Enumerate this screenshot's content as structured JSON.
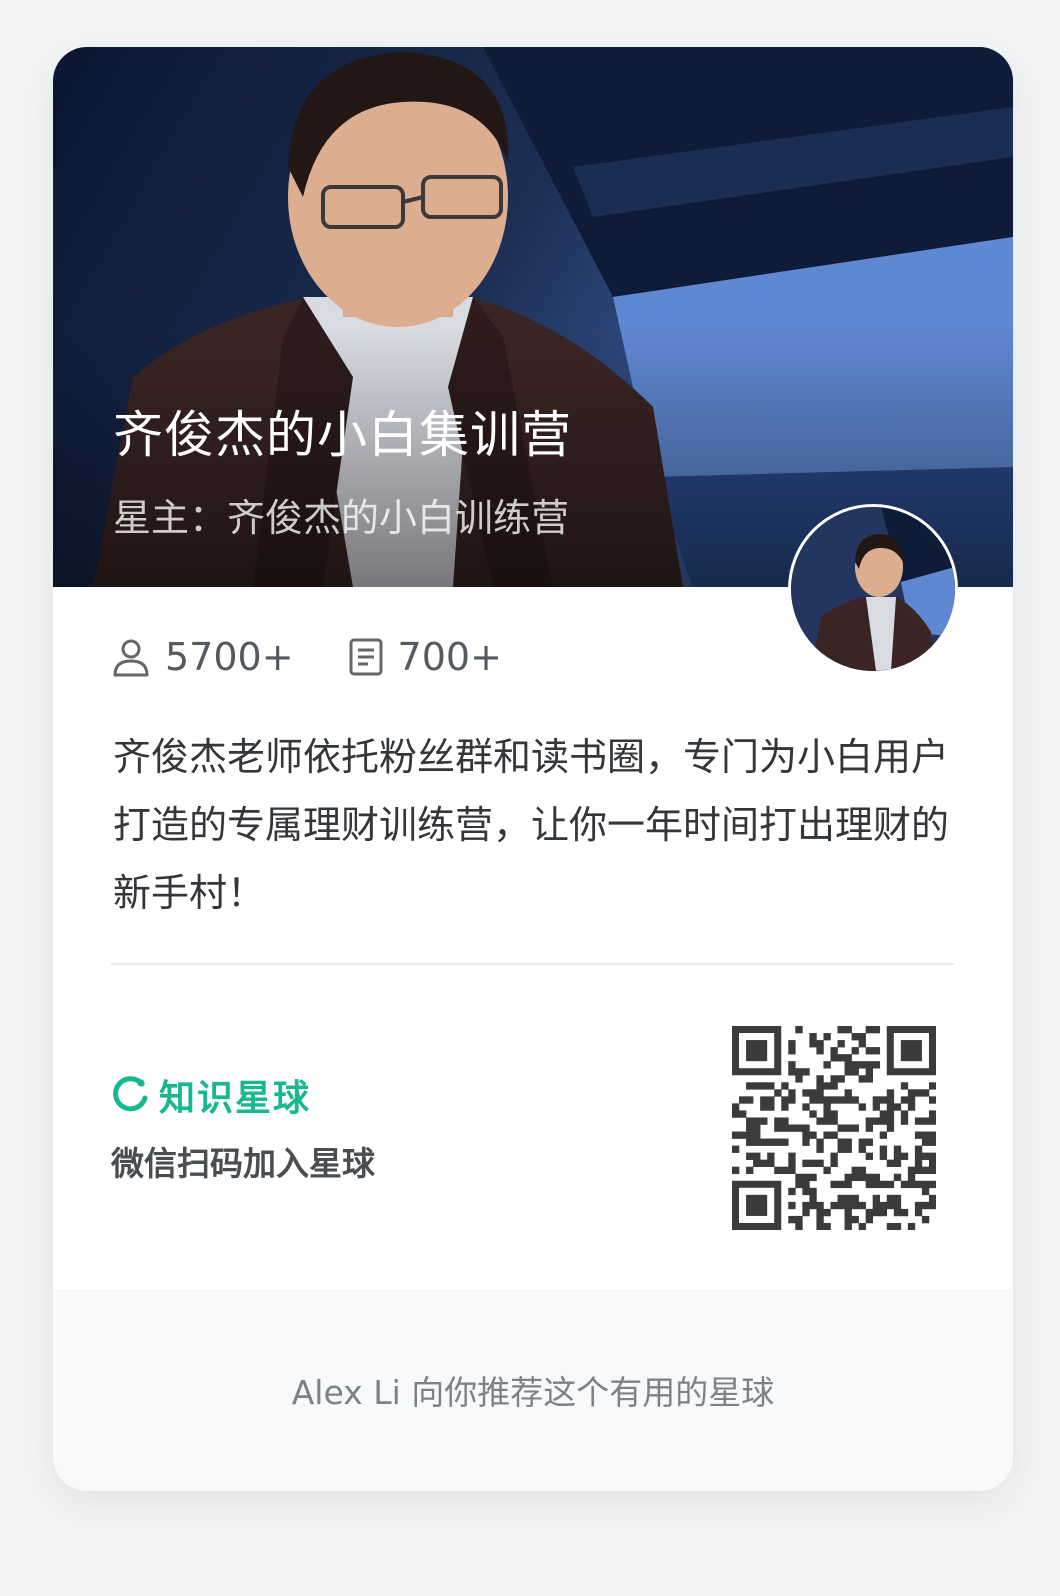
{
  "card": {
    "title": "齐俊杰的小白集训营",
    "owner": "星主：齐俊杰的小白训练营",
    "members": "5700+",
    "posts": "700+",
    "description": "齐俊杰老师依托粉丝群和读书圈，专门为小白用户打造的专属理财训练营，让你一年时间打出理财的新手村！"
  },
  "brand": {
    "name": "知识星球",
    "scan_hint": "微信扫码加入星球"
  },
  "footer": {
    "recommend_text": "Alex Li 向你推荐这个有用的星球"
  },
  "icons": {
    "members": "user-icon",
    "posts": "document-icon",
    "brand": "planet-logo-icon",
    "qr": "qr-code"
  },
  "colors": {
    "brand_green": "#17b890",
    "background": "#f3f4f6",
    "card": "#ffffff"
  }
}
